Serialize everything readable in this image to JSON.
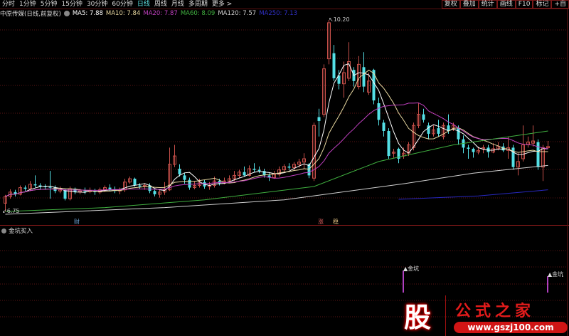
{
  "toolbar": {
    "periods": [
      "分时",
      "1分钟",
      "5分钟",
      "15分钟",
      "30分钟",
      "60分钟",
      "日线",
      "周线",
      "月线",
      "多周期",
      "更多 >"
    ],
    "active": "日线",
    "right_buttons": [
      "复权",
      "叠加",
      "统计",
      "画线",
      "F10",
      "标记",
      "+自"
    ]
  },
  "info": {
    "stock": "中原传媒(日线,前复权)",
    "ma5": "MA5: 7.88",
    "ma10": "MA10: 7.84",
    "ma20": "MA20: 7.87",
    "ma60": "MA60: 8.09",
    "ma120": "MA120: 7.57",
    "ma250": "MA250: 7.13"
  },
  "colors": {
    "up": "#c8504a",
    "down": "#54e0e6",
    "ma5": "#ffffff",
    "ma10": "#e8d8a0",
    "ma20": "#c040c0",
    "ma60": "#40b040",
    "ma120": "#d0d0d0",
    "ma250": "#2828c0",
    "grid": "#5a1414"
  },
  "chart_data": {
    "type": "candlestick",
    "high_label": "10.20",
    "low_label": "6.75",
    "ylim": [
      6.6,
      10.3
    ],
    "candles_ohlc": [
      [
        6.9,
        7.05,
        6.75,
        7.02
      ],
      [
        7.02,
        7.15,
        6.98,
        7.1
      ],
      [
        7.1,
        7.14,
        7.02,
        7.06
      ],
      [
        7.06,
        7.22,
        7.04,
        7.18
      ],
      [
        7.18,
        7.22,
        7.12,
        7.16
      ],
      [
        7.16,
        7.3,
        7.12,
        7.24
      ],
      [
        7.24,
        7.4,
        7.18,
        7.22
      ],
      [
        7.22,
        7.26,
        7.15,
        7.2
      ],
      [
        7.2,
        7.24,
        7.14,
        7.19
      ],
      [
        7.19,
        7.48,
        6.98,
        7.18
      ],
      [
        7.18,
        7.22,
        7.08,
        7.12
      ],
      [
        7.12,
        7.2,
        7.08,
        7.14
      ],
      [
        7.14,
        7.16,
        6.95,
        6.98
      ],
      [
        6.98,
        7.2,
        6.95,
        7.16
      ],
      [
        7.16,
        7.18,
        7.06,
        7.1
      ],
      [
        7.1,
        7.16,
        7.06,
        7.12
      ],
      [
        7.12,
        7.18,
        7.06,
        7.11
      ],
      [
        7.11,
        7.18,
        7.08,
        7.12
      ],
      [
        7.12,
        7.16,
        7.05,
        7.1
      ],
      [
        7.1,
        7.18,
        7.06,
        7.14
      ],
      [
        7.14,
        7.22,
        7.1,
        7.18
      ],
      [
        7.18,
        7.24,
        7.12,
        7.15
      ],
      [
        7.15,
        7.2,
        7.08,
        7.12
      ],
      [
        7.12,
        7.18,
        7.06,
        7.14
      ],
      [
        7.14,
        7.34,
        7.1,
        7.28
      ],
      [
        7.28,
        7.38,
        7.25,
        7.34
      ],
      [
        7.34,
        7.36,
        7.2,
        7.22
      ],
      [
        7.22,
        7.26,
        7.16,
        7.2
      ],
      [
        7.2,
        7.26,
        7.14,
        7.22
      ],
      [
        7.22,
        7.26,
        7.08,
        7.12
      ],
      [
        7.12,
        7.14,
        7.02,
        7.06
      ],
      [
        7.06,
        7.14,
        7.0,
        7.1
      ],
      [
        7.1,
        7.28,
        7.05,
        7.14
      ],
      [
        7.14,
        7.9,
        7.12,
        7.6
      ],
      [
        7.6,
        7.95,
        7.55,
        7.75
      ],
      [
        7.52,
        7.6,
        7.38,
        7.42
      ],
      [
        7.4,
        7.45,
        7.25,
        7.32
      ],
      [
        7.32,
        7.36,
        7.14,
        7.18
      ],
      [
        7.18,
        7.3,
        7.15,
        7.22
      ],
      [
        7.22,
        7.34,
        7.18,
        7.28
      ],
      [
        7.28,
        7.32,
        7.16,
        7.2
      ],
      [
        7.2,
        7.28,
        7.14,
        7.22
      ],
      [
        7.22,
        7.38,
        7.18,
        7.3
      ],
      [
        7.3,
        7.34,
        7.22,
        7.26
      ],
      [
        7.26,
        7.36,
        7.24,
        7.3
      ],
      [
        7.3,
        7.4,
        7.28,
        7.34
      ],
      [
        7.34,
        7.48,
        7.3,
        7.4
      ],
      [
        7.4,
        7.5,
        7.36,
        7.46
      ],
      [
        7.46,
        7.56,
        7.38,
        7.4
      ],
      [
        7.4,
        7.58,
        7.38,
        7.52
      ],
      [
        7.52,
        7.62,
        7.46,
        7.5
      ],
      [
        7.5,
        7.56,
        7.44,
        7.48
      ],
      [
        7.48,
        7.52,
        7.36,
        7.4
      ],
      [
        7.4,
        7.44,
        7.3,
        7.36
      ],
      [
        7.36,
        7.48,
        7.34,
        7.42
      ],
      [
        7.42,
        7.56,
        7.38,
        7.5
      ],
      [
        7.5,
        7.6,
        7.46,
        7.56
      ],
      [
        7.56,
        7.62,
        7.5,
        7.54
      ],
      [
        7.54,
        7.64,
        7.5,
        7.6
      ],
      [
        7.6,
        7.7,
        7.54,
        7.64
      ],
      [
        7.64,
        7.8,
        7.52,
        7.7
      ],
      [
        7.6,
        7.62,
        7.35,
        7.4
      ],
      [
        7.35,
        8.35,
        7.3,
        8.3
      ],
      [
        8.45,
        8.6,
        8.1,
        8.38
      ],
      [
        8.5,
        9.4,
        8.45,
        9.32
      ],
      [
        9.5,
        10.2,
        9.4,
        10.15
      ],
      [
        9.6,
        9.75,
        9.1,
        9.15
      ],
      [
        9.2,
        9.3,
        8.95,
        9.05
      ],
      [
        9.05,
        9.45,
        8.8,
        9.25
      ],
      [
        9.15,
        9.8,
        9.1,
        9.45
      ],
      [
        9.3,
        9.35,
        9.0,
        9.1
      ],
      [
        9.0,
        9.55,
        8.95,
        9.4
      ],
      [
        9.35,
        9.62,
        8.9,
        9.0
      ],
      [
        8.9,
        9.25,
        8.85,
        9.1
      ],
      [
        9.3,
        9.32,
        8.68,
        8.75
      ],
      [
        8.7,
        8.8,
        8.3,
        8.4
      ],
      [
        8.35,
        8.4,
        8.1,
        8.2
      ],
      [
        8.2,
        8.25,
        7.7,
        7.75
      ],
      [
        7.8,
        7.88,
        7.72,
        7.82
      ],
      [
        7.88,
        7.9,
        7.62,
        7.7
      ],
      [
        7.75,
        7.9,
        7.7,
        7.8
      ],
      [
        7.8,
        8.0,
        7.75,
        7.95
      ],
      [
        7.9,
        8.35,
        7.85,
        8.3
      ],
      [
        8.3,
        8.7,
        8.25,
        8.5
      ],
      [
        8.5,
        8.6,
        8.35,
        8.4
      ],
      [
        8.3,
        8.35,
        8.05,
        8.15
      ],
      [
        8.15,
        8.3,
        8.1,
        8.22
      ],
      [
        8.25,
        8.4,
        8.1,
        8.15
      ],
      [
        8.1,
        8.35,
        8.05,
        8.3
      ],
      [
        8.3,
        8.5,
        8.15,
        8.2
      ],
      [
        8.25,
        8.35,
        8.2,
        8.3
      ],
      [
        8.25,
        8.3,
        7.95,
        8.05
      ],
      [
        8.05,
        8.12,
        7.8,
        7.9
      ],
      [
        7.9,
        7.95,
        7.7,
        7.88
      ],
      [
        7.88,
        7.9,
        7.72,
        7.82
      ],
      [
        7.82,
        7.92,
        7.78,
        7.85
      ],
      [
        7.88,
        7.95,
        7.8,
        7.9
      ],
      [
        7.9,
        7.95,
        7.72,
        7.82
      ],
      [
        7.82,
        7.98,
        7.8,
        7.88
      ],
      [
        7.88,
        8.0,
        7.85,
        7.92
      ],
      [
        7.92,
        7.98,
        7.82,
        7.85
      ],
      [
        7.85,
        8.1,
        7.7,
        7.9
      ],
      [
        7.9,
        7.95,
        7.5,
        7.55
      ],
      [
        7.55,
        7.8,
        7.4,
        7.65
      ],
      [
        7.7,
        8.3,
        7.65,
        7.95
      ],
      [
        7.95,
        8.1,
        7.9,
        8.0
      ],
      [
        7.98,
        8.3,
        7.92,
        8.02
      ],
      [
        8.0,
        8.05,
        7.5,
        7.55
      ],
      [
        7.55,
        7.95,
        7.3,
        7.9
      ],
      [
        7.9,
        8.02,
        7.88,
        7.92
      ]
    ],
    "ma60_points": [
      [
        0,
        6.75
      ],
      [
        20,
        6.82
      ],
      [
        40,
        6.96
      ],
      [
        62,
        7.2
      ],
      [
        75,
        7.65
      ],
      [
        90,
        7.95
      ],
      [
        109,
        8.2
      ]
    ],
    "ma120_points": [
      [
        0,
        6.7
      ],
      [
        32,
        6.82
      ],
      [
        56,
        6.96
      ],
      [
        80,
        7.25
      ],
      [
        94,
        7.44
      ],
      [
        109,
        7.58
      ]
    ],
    "ma250_points": [
      [
        79,
        6.97
      ],
      [
        95,
        7.03
      ],
      [
        109,
        7.14
      ]
    ],
    "event_labels": [
      {
        "index": 14,
        "text": "财",
        "color": "#6aa0d0"
      },
      {
        "index": 63,
        "text": "涨",
        "color": "#e06060"
      },
      {
        "index": 66,
        "text": "稳",
        "color": "#e0c080"
      }
    ]
  },
  "sub_panel": {
    "title": "金坑买入",
    "signals": [
      {
        "index": 80,
        "label": "金坑"
      },
      {
        "index": 109,
        "label": "金坑"
      }
    ]
  },
  "watermark": {
    "mark": "股",
    "name": "公式之家",
    "url": "www.gszj100.com"
  }
}
